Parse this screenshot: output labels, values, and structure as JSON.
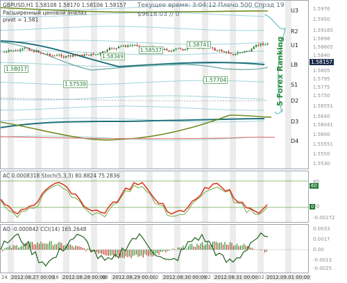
{
  "main": {
    "header_line1": "GBPUSD,H1  1.58108 1.58170 1.58106 1.58157",
    "header_line2": "Расширенный ценовой анализ",
    "header_line3": "pivot = 1.581",
    "info_time": "Текущее время: 3:04:12 Плечо 500 Спрэд 19",
    "info_balance": "$9618.03      // 0",
    "vertical_label": "5 Forex Ranking",
    "current_price": "1.58157",
    "level_labels": [
      "U3",
      "R2",
      "U1",
      "LB",
      "S1",
      "D2",
      "D3",
      "D4"
    ],
    "price_tags": [
      "1.58017",
      "1.57539",
      "1.58349",
      "1.58537",
      "1.58741",
      "1.57704"
    ],
    "scale_labels": [
      "1.5976",
      "1.5950",
      "1.59165",
      "1.5898",
      "1.58605",
      "1.5840",
      "1.58157",
      "1.5805",
      "1.5795",
      "1.5775",
      "1.5750",
      "1.56551",
      "1.5640",
      "1.56041",
      "1.5600",
      "1.55551",
      "1.5550",
      "1.5530"
    ]
  },
  "stoch": {
    "header": "AC 0.0008318  Stoch(5,3,3) 80.8824 75.2836",
    "scale_labels": [
      "80",
      "20",
      "-0.00272"
    ],
    "tags": [
      "60",
      "0"
    ]
  },
  "ao": {
    "header": "AO -0.000842  CCI(14) 165.2648",
    "scale_labels": [
      "0.0033",
      "0.0017",
      "0.00",
      "-0.0013",
      "-0.0025"
    ]
  },
  "time_axis": {
    "labels": [
      "2012.08.27 00:00",
      "2012.08.28 00:00",
      "2012.08.29 00:00",
      "2012.08.30 00:00",
      "2012.08.31 00:00",
      "2012.09.01 00:00"
    ],
    "gap_labels": [
      "24",
      "16",
      "08",
      "02",
      "02",
      "02"
    ]
  },
  "colors": {
    "bull_candle": "#1f7a32",
    "bear_candle": "#c0392b",
    "ma_teal": "#1d6f7a",
    "ma_olive": "#6f8c1f",
    "pivot_band": "#9fd3d8",
    "stoch_main": "#d8391f",
    "stoch_signal": "#6fa84a",
    "ao_up": "#2f8f2f",
    "ao_down": "#c0392b",
    "cci": "#1a5e1a"
  }
}
